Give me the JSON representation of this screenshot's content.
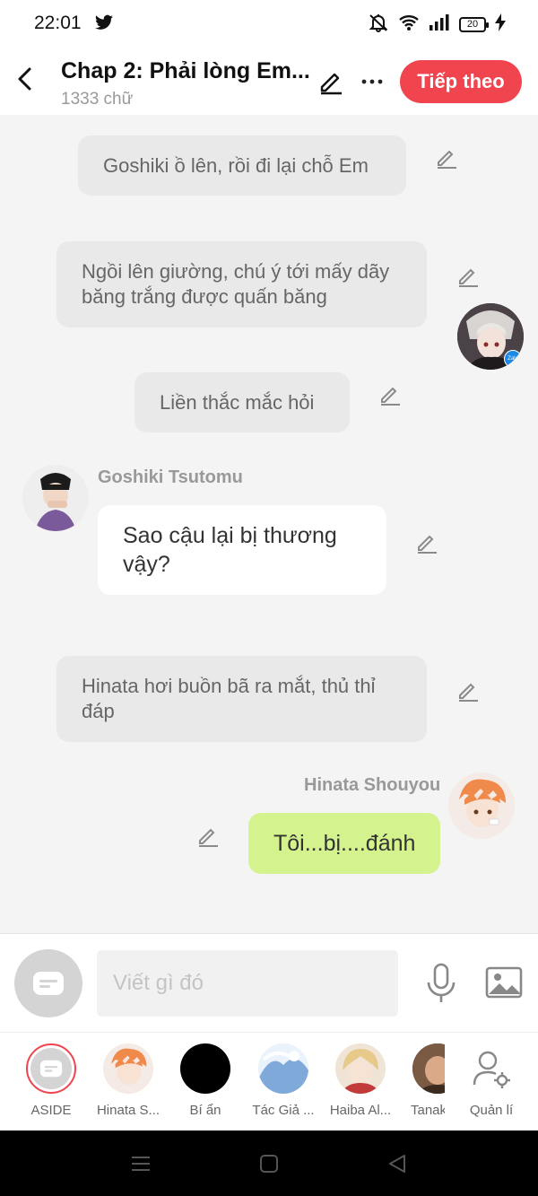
{
  "status_bar": {
    "time": "22:01",
    "battery": "20"
  },
  "header": {
    "title": "Chap 2: Phải lòng Em...",
    "word_count": "1333 chữ",
    "next_label": "Tiếp theo"
  },
  "messages": [
    {
      "type": "narration",
      "text": "Goshiki ồ lên, rồi đi lại chỗ Em"
    },
    {
      "type": "narration",
      "text": "Ngồi lên giường, chú ý tới mấy dãy băng trắng được quấn băng"
    },
    {
      "type": "narration",
      "text": "Liền thắc mắc hỏi"
    },
    {
      "type": "left",
      "sender": "Goshiki Tsutomu",
      "text": "Sao cậu lại bị thương vậy?"
    },
    {
      "type": "narration",
      "text": "Hinata hơi buồn bã ra mắt, thủ thỉ đáp"
    },
    {
      "type": "right",
      "sender": "Hinata Shouyou",
      "text": "Tôi...bị....đánh"
    }
  ],
  "zalo_badge": "Zalo",
  "input": {
    "placeholder": "Viết gì đó"
  },
  "characters": [
    {
      "label": "ASIDE"
    },
    {
      "label": "Hinata S..."
    },
    {
      "label": "Bí ẩn"
    },
    {
      "label": "Tác Giả ..."
    },
    {
      "label": "Haiba Al..."
    },
    {
      "label": "Tanak"
    },
    {
      "label": "Quản lí"
    }
  ],
  "colors": {
    "accent": "#f0454f",
    "narration_bubble": "#e9e9e9",
    "right_bubble": "#d4f38e",
    "left_bubble": "#ffffff",
    "background": "#f4f4f4"
  }
}
